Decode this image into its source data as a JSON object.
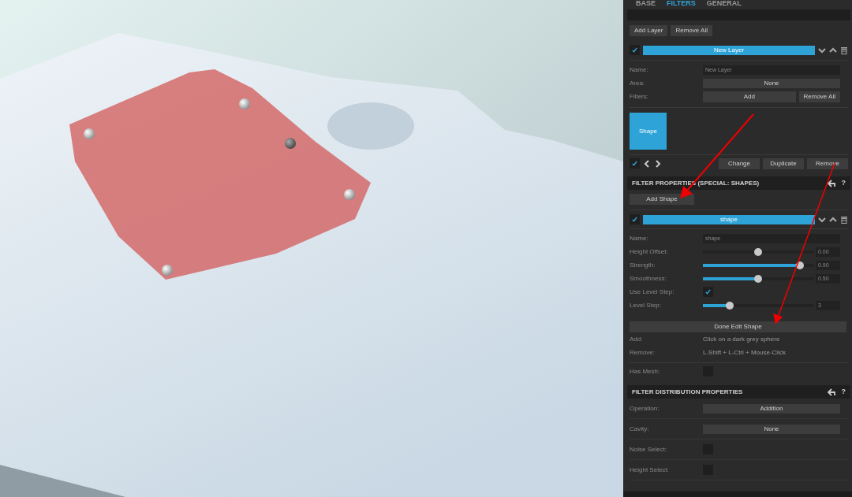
{
  "tabs": [
    {
      "label": "BASE",
      "selected": false
    },
    {
      "label": "FILTERS",
      "selected": true
    },
    {
      "label": "GENERAL",
      "selected": false
    }
  ],
  "layer_toolbar": [
    "Add Layer",
    "Remove All"
  ],
  "layer": {
    "enabled": true,
    "title": "New Layer"
  },
  "layer_rows": [
    {
      "kind": "text",
      "label": "Name:",
      "value": "New Layer"
    },
    {
      "kind": "select",
      "label": "Area:",
      "value": "None"
    },
    {
      "kind": "buttons",
      "label": "Filters:",
      "buttons": [
        "Add",
        "Remove All"
      ]
    }
  ],
  "filter_tiles": [
    {
      "label": "Shape",
      "selected": true
    }
  ],
  "filter_nav": {
    "enabled": true,
    "buttons": [
      "Change",
      "Duplicate",
      "Remove"
    ]
  },
  "filter_properties": {
    "title": "FILTER PROPERTIES (SPECIAL: SHAPES)",
    "help": "?",
    "add_button": "Add Shape",
    "shape": {
      "enabled": true,
      "title": "shape"
    },
    "rows": [
      {
        "kind": "text",
        "label": "Name:",
        "value": "shape"
      },
      {
        "kind": "bipolar",
        "label": "Height Offset:",
        "level": 0.5,
        "reading": "0.00"
      },
      {
        "kind": "slider",
        "label": "Strength:",
        "level": 0.88,
        "reading": "0.90"
      },
      {
        "kind": "slider",
        "label": "Smoothness:",
        "level": 0.5,
        "reading": "0.50"
      },
      {
        "kind": "check",
        "label": "Use Level Step:",
        "checked": true
      },
      {
        "kind": "slider",
        "label": "Level Step:",
        "level": 0.24,
        "reading": "3"
      }
    ],
    "edit_button": "Done Edit Shape",
    "hints": [
      {
        "label": "Add:",
        "text": "Click on a dark grey sphere"
      },
      {
        "label": "Remove:",
        "text": "L-Shift + L-Ctrl + Mouse-Click"
      }
    ],
    "has_mesh": {
      "label": "Has Mesh:",
      "checked": false
    }
  },
  "distribution": {
    "title": "FILTER DISTRIBUTION PROPERTIES",
    "help": "?",
    "rows": [
      {
        "kind": "select",
        "label": "Operation:",
        "value": "Addition"
      },
      {
        "kind": "select",
        "label": "Cavity:",
        "value": "None"
      },
      {
        "kind": "check",
        "label": "Noise Select:",
        "checked": false
      },
      {
        "kind": "check",
        "label": "Height Select:",
        "checked": false
      }
    ]
  }
}
